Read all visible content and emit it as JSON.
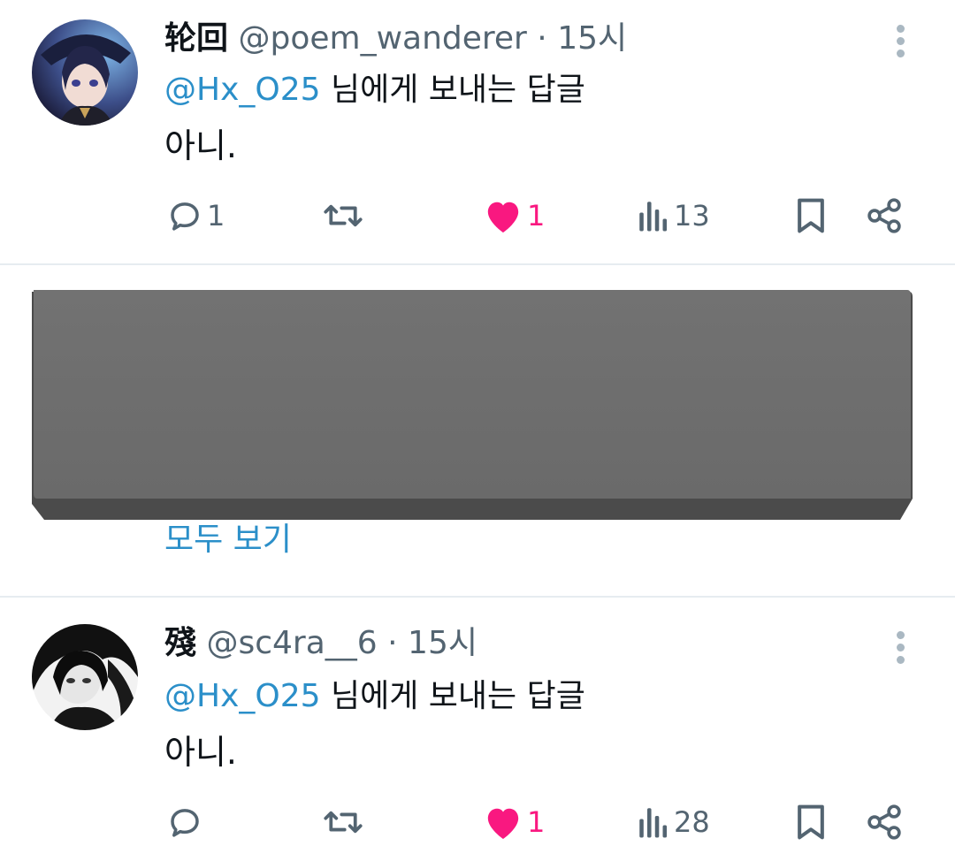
{
  "tweets": [
    {
      "name": "轮回",
      "handle": "@poem_wanderer",
      "dot": "·",
      "time": "15시",
      "mention": "@Hx_O25",
      "reply_suffix": " 님에게 보내는 답글",
      "text": "아니.",
      "replies": "1",
      "retweets": "",
      "likes": "1",
      "views": "13"
    },
    {
      "name": "殘",
      "handle": "@sc4ra__6",
      "dot": "·",
      "time": "15시",
      "mention": "@Hx_O25",
      "reply_suffix": " 님에게 보내는 답글",
      "text": "아니.",
      "replies": "",
      "retweets": "",
      "likes": "1",
      "views": "28"
    }
  ],
  "thread": {
    "see_all": "모두 보기"
  },
  "icons": {
    "reply": "reply-icon",
    "retweet": "retweet-icon",
    "like": "heart-icon",
    "views": "views-icon",
    "bookmark": "bookmark-icon",
    "share": "share-icon",
    "more": "more-icon"
  },
  "colors": {
    "accent_link": "#2b8fc9",
    "like": "#f91880",
    "muted": "#536471",
    "icon": "#536471",
    "divider": "#e6ecf0",
    "redaction": "#707070"
  }
}
